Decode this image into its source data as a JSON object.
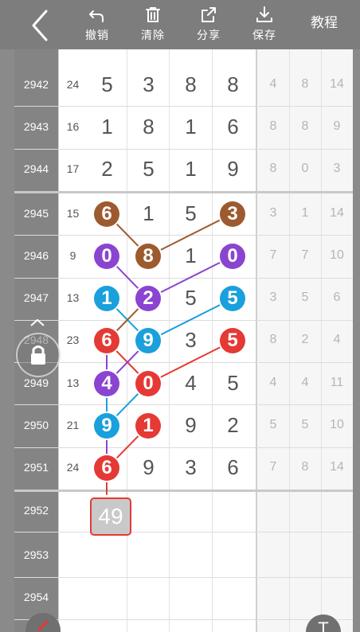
{
  "toolbar": {
    "undo_label": "撤销",
    "clear_label": "清除",
    "share_label": "分享",
    "save_label": "保存",
    "tutorial_label": "教程"
  },
  "rows": [
    {
      "issue": "2942",
      "sum": "24",
      "digits": [
        "5",
        "3",
        "8",
        "8"
      ],
      "right": [
        "4",
        "8",
        "14"
      ]
    },
    {
      "issue": "2943",
      "sum": "16",
      "digits": [
        "1",
        "8",
        "1",
        "6"
      ],
      "right": [
        "8",
        "8",
        "9"
      ]
    },
    {
      "issue": "2944",
      "sum": "17",
      "digits": [
        "2",
        "5",
        "1",
        "9"
      ],
      "right": [
        "8",
        "0",
        "3"
      ]
    },
    {
      "issue": "2945",
      "sum": "15",
      "digits": [
        "6",
        "1",
        "5",
        "3"
      ],
      "right": [
        "3",
        "1",
        "14"
      ]
    },
    {
      "issue": "2946",
      "sum": "9",
      "digits": [
        "0",
        "8",
        "1",
        "0"
      ],
      "right": [
        "7",
        "7",
        "10"
      ]
    },
    {
      "issue": "2947",
      "sum": "13",
      "digits": [
        "1",
        "2",
        "5",
        "5"
      ],
      "right": [
        "3",
        "5",
        "6"
      ]
    },
    {
      "issue": "2948",
      "sum": "23",
      "digits": [
        "6",
        "9",
        "3",
        "5"
      ],
      "right": [
        "8",
        "2",
        "4"
      ]
    },
    {
      "issue": "2949",
      "sum": "13",
      "digits": [
        "4",
        "0",
        "4",
        "5"
      ],
      "right": [
        "4",
        "4",
        "11"
      ]
    },
    {
      "issue": "2950",
      "sum": "21",
      "digits": [
        "9",
        "1",
        "9",
        "2"
      ],
      "right": [
        "5",
        "5",
        "10"
      ]
    },
    {
      "issue": "2951",
      "sum": "24",
      "digits": [
        "6",
        "9",
        "3",
        "6"
      ],
      "right": [
        "7",
        "8",
        "14"
      ]
    },
    {
      "issue": "2952",
      "sum": "",
      "digits": [
        "",
        "",
        "",
        ""
      ],
      "right": [
        "",
        "",
        ""
      ]
    },
    {
      "issue": "2953",
      "sum": "",
      "digits": [
        "",
        "",
        "",
        ""
      ],
      "right": [
        "",
        "",
        ""
      ]
    },
    {
      "issue": "2954",
      "sum": "",
      "digits": [
        "",
        "",
        "",
        ""
      ],
      "right": [
        "",
        "",
        ""
      ]
    }
  ],
  "highlights": [
    {
      "row": 3,
      "col": 0,
      "color": "#9c5a2e"
    },
    {
      "row": 3,
      "col": 3,
      "color": "#9c5a2e"
    },
    {
      "row": 4,
      "col": 1,
      "color": "#9c5a2e"
    },
    {
      "row": 4,
      "col": 0,
      "color": "#8a44d0"
    },
    {
      "row": 4,
      "col": 3,
      "color": "#8a44d0"
    },
    {
      "row": 5,
      "col": 1,
      "color": "#8a44d0"
    },
    {
      "row": 5,
      "col": 0,
      "color": "#1aa0dc"
    },
    {
      "row": 5,
      "col": 3,
      "color": "#1aa0dc"
    },
    {
      "row": 6,
      "col": 1,
      "color": "#1aa0dc"
    },
    {
      "row": 6,
      "col": 0,
      "color": "#e53935"
    },
    {
      "row": 6,
      "col": 3,
      "color": "#e53935"
    },
    {
      "row": 7,
      "col": 1,
      "color": "#e53935"
    },
    {
      "row": 7,
      "col": 0,
      "color": "#8a44d0"
    },
    {
      "row": 8,
      "col": 0,
      "color": "#1aa0dc"
    },
    {
      "row": 8,
      "col": 1,
      "color": "#e53935"
    },
    {
      "row": 9,
      "col": 0,
      "color": "#e53935"
    }
  ],
  "prediction": {
    "row": 10,
    "value": "49"
  },
  "fab_right_label": "T"
}
